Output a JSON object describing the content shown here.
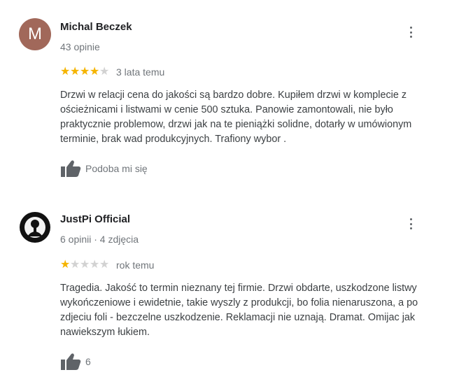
{
  "reviews": [
    {
      "author": "Michal Beczek",
      "avatar_letter": "M",
      "avatar_color": "#a1685a",
      "meta": "43 opinie",
      "rating": 4,
      "date": "3 lata temu",
      "text": "Drzwi w relacji cena do jakości są bardzo dobre. Kupiłem drzwi w komplecie z ościeżnicami i listwami w cenie 500 sztuka. Panowie zamontowali, nie było praktycznie problemow, drzwi  jak na te pieniążki solidne, dotarły w umówionym terminie, brak wad produkcyjnych. Trafiony wybor .",
      "like_label": "Podoba mi się",
      "more_icon": "vertical-dots-icon",
      "like_icon": "thumbs-up-icon"
    },
    {
      "author": "JustPi Official",
      "avatar_icon": "profile-photo-icon",
      "meta": "6 opinii · 4 zdjęcia",
      "rating": 1,
      "date": "rok temu",
      "text": "Tragedia. Jakość to termin nieznany tej firmie. Drzwi obdarte, uszkodzone listwy wykończeniowe i ewidetnie, takie wyszly z produkcji, bo folia nienaruszona, a po zdjeciu foli - bezczelne uszkodzenie. Reklamacji nie uznają. Dramat. Omijac jak nawiekszym łukiem.",
      "like_label": "6",
      "more_icon": "vertical-dots-icon",
      "like_icon": "thumbs-up-icon"
    }
  ],
  "colors": {
    "star_filled": "#f5b400",
    "star_empty": "#d2d2d2",
    "secondary_text": "#70757a"
  }
}
